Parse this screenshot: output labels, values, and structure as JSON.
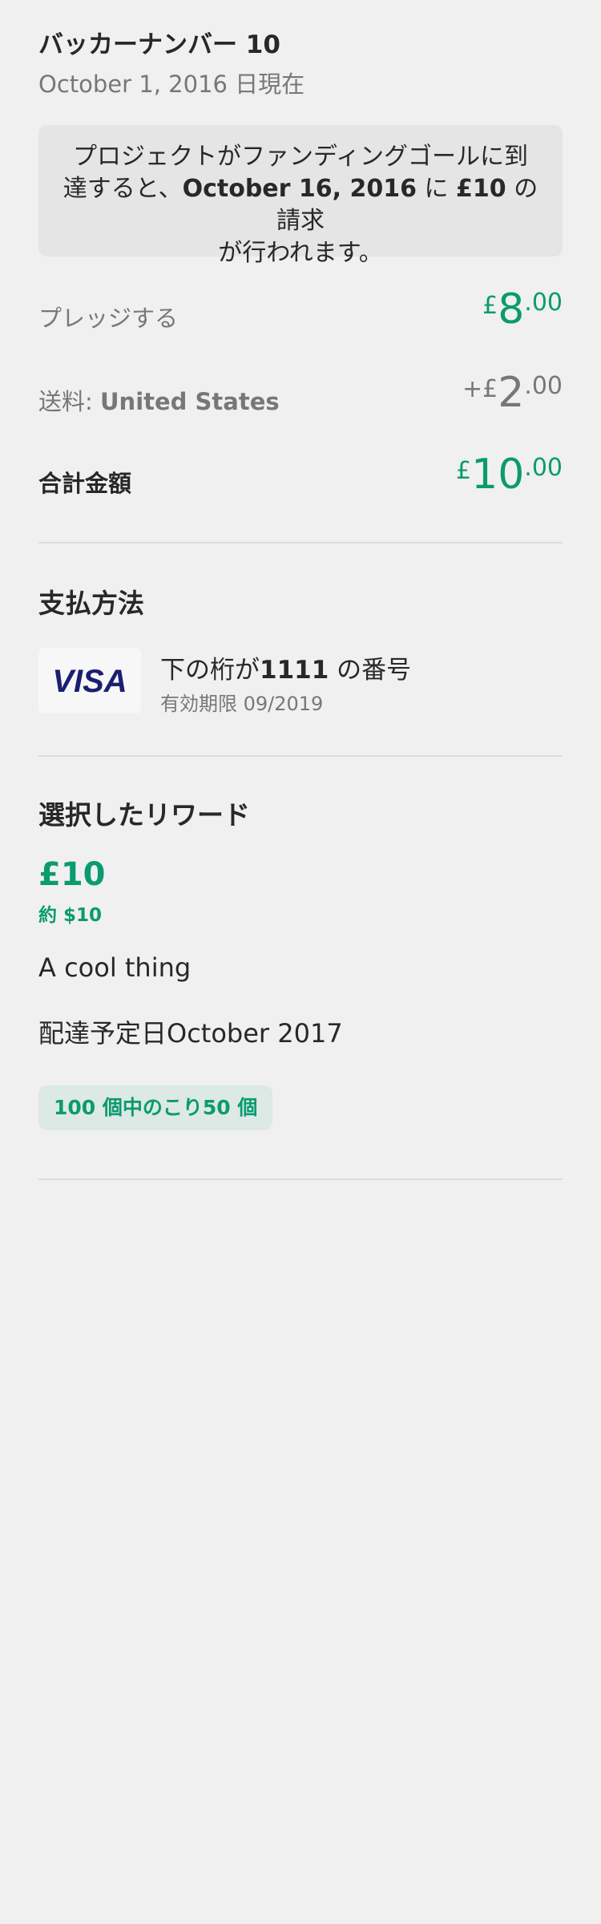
{
  "header": {
    "backer_number": "バッカーナンバー 10",
    "as_of_date": "October 1, 2016 日現在"
  },
  "notice": {
    "line1": "プロジェクトがファンディングゴールに到",
    "line2_pre": "達すると、",
    "charge_date": "October 16, 2016",
    "line2_mid": " に ",
    "charge_amount": "£10",
    "line2_post": " の請求",
    "line3": "が行われます。"
  },
  "pledge": {
    "label": "プレッジする",
    "currency": "£",
    "whole": "8",
    "cents": ".00"
  },
  "shipping": {
    "label": "送料:",
    "location": "United States",
    "prefix": "+£",
    "whole": "2",
    "cents": ".00"
  },
  "total": {
    "label": "合計金額",
    "currency": "£",
    "whole": "10",
    "cents": ".00"
  },
  "payment": {
    "title": "支払方法",
    "card_brand": "VISA",
    "card_prefix": "下の桁が",
    "card_last4": "1111",
    "card_suffix": " の番号",
    "expiry": "有効期限 09/2019"
  },
  "reward": {
    "title": "選択したリワード",
    "amount": "£10",
    "converted": "約 $10",
    "description": "A cool thing",
    "delivery": "配達予定日October 2017",
    "remaining": "100 個中のこり50 個"
  },
  "colors": {
    "accent_green": "#0a9b6f",
    "visa_blue": "#1a1f71",
    "background": "#f0f0f0"
  }
}
